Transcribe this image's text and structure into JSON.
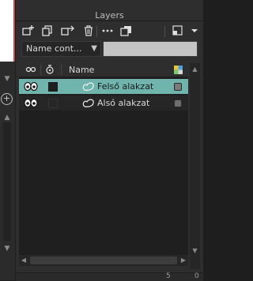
{
  "panel": {
    "title": "Layers"
  },
  "toolbar": {
    "buttons": [
      {
        "name": "new-layer-icon",
        "glyph": "⊞"
      },
      {
        "name": "new-group-icon",
        "glyph": "⧉"
      },
      {
        "name": "move-layer-icon",
        "glyph": "⇥"
      },
      {
        "name": "delete-layer-icon",
        "glyph": "🗑"
      },
      {
        "name": "more-options-icon",
        "glyph": "•••"
      },
      {
        "name": "duplicate-layer-icon",
        "glyph": "❐"
      },
      {
        "name": "collapse-panel-icon",
        "glyph": "◱"
      },
      {
        "name": "panel-menu-icon",
        "glyph": "▾"
      }
    ]
  },
  "filter": {
    "selected": "Name cont...",
    "arrow": "▼",
    "search_value": ""
  },
  "columns": {
    "visibility_icon": "👁",
    "lock_icon": "Ò",
    "name": "Name",
    "color_icon": "▦"
  },
  "layers": [
    {
      "name": "Felső alakzat",
      "selected": true,
      "swatch": "#1a1a1a",
      "status_color": "#7a7a7a"
    },
    {
      "name": "Alsó alakzat",
      "selected": false,
      "swatch": "#262626",
      "status_color": "#6e6e6e"
    }
  ],
  "colors": {
    "accent": "#6fb5ad",
    "panel_bg": "#2e2e2e",
    "list_bg": "#1f1f1f"
  },
  "footer": {
    "left_text": "5",
    "right_text": "0"
  }
}
